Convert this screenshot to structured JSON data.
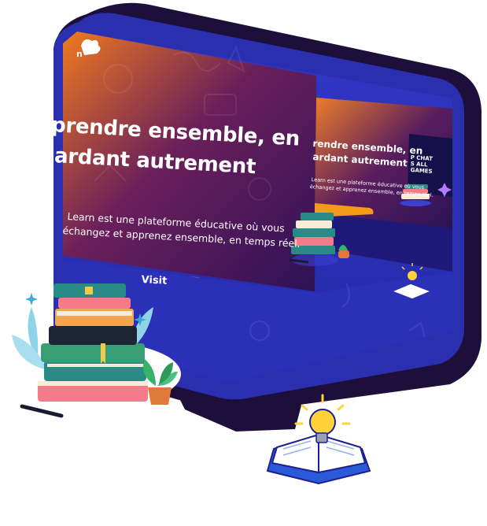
{
  "hero": {
    "headline_line1": "prendre ensemble, en",
    "headline_line2": "ardant autrement",
    "paragraph_line1": "Learn est une plateforme éducative où vous",
    "paragraph_line2": "échangez et apprenez ensemble, en temps réel.",
    "cta_label": "Visit",
    "logo_letter": "n"
  },
  "mini_screen": {
    "headline_line1": "rendre ensemble, en",
    "headline_line2": "ardant autrement",
    "paragraph_line1": "Learn est une plateforme éducative où vous",
    "paragraph_line2": "échangez et apprenez ensemble, en temps réel.",
    "phone_line1": "P CHAT",
    "phone_line2": "S ALL",
    "phone_line3": "GAMES"
  },
  "colors": {
    "monitor_body": "#2a2fb0",
    "monitor_edge": "#1f1f85",
    "monitor_back": "#1e0f3a",
    "screen_orange": "#f07a1e",
    "screen_purple": "#3a1460",
    "cta_orange": "#f39a1a",
    "book_teal": "#2a8a86",
    "book_pink": "#f47b8a",
    "book_cream": "#f5ecd9",
    "bulb_yellow": "#ffd23a"
  },
  "icons": [
    "logo-icon",
    "books-stack-icon",
    "plant-icon",
    "pen-icon",
    "lightbulb-book-icon",
    "sparkle-icon"
  ]
}
